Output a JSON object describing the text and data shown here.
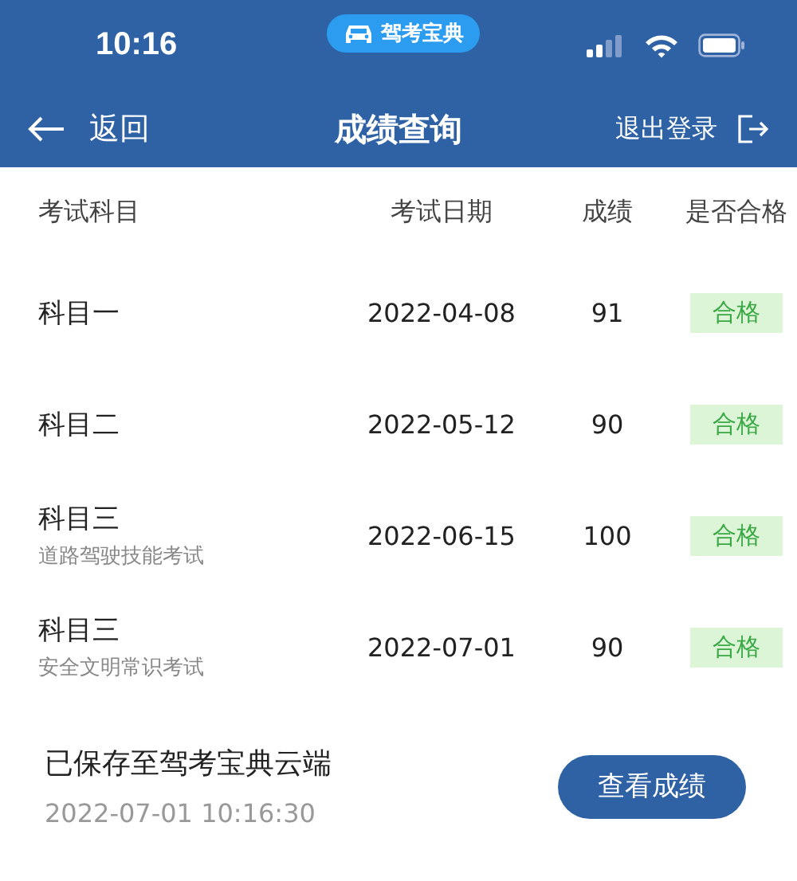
{
  "status_bar": {
    "time": "10:16",
    "app_badge": "驾考宝典"
  },
  "nav": {
    "back": "返回",
    "title": "成绩查询",
    "logout": "退出登录"
  },
  "table": {
    "columns": [
      "考试科目",
      "考试日期",
      "成绩",
      "是否合格"
    ],
    "rows": [
      {
        "subject": "科目一",
        "date": "2022-04-08",
        "score": "91",
        "result": "合格",
        "passed": true
      },
      {
        "subject": "科目二",
        "date": "2022-05-12",
        "score": "90",
        "result": "合格",
        "passed": true
      },
      {
        "subject": "科目三",
        "subtitle": "道路驾驶技能考试",
        "date": "2022-06-15",
        "score": "100",
        "result": "合格",
        "passed": true
      },
      {
        "subject": "科目三",
        "subtitle": "安全文明常识考试",
        "date": "2022-07-01",
        "score": "90",
        "result": "合格",
        "passed": true
      }
    ]
  },
  "footer": {
    "saved": "已保存至驾考宝典云端",
    "timestamp": "2022-07-01 10:16:30",
    "button": "查看成绩"
  }
}
